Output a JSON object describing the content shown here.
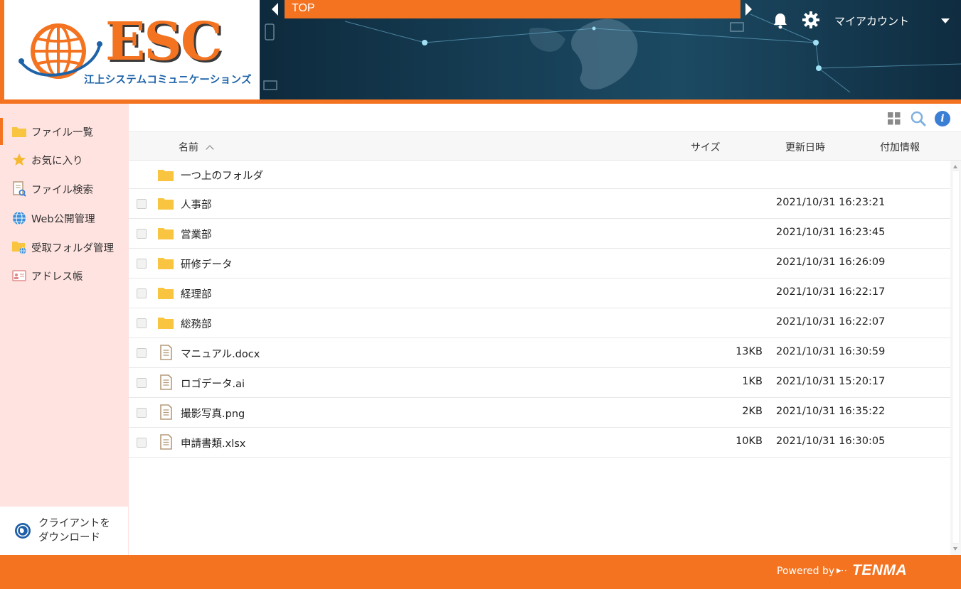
{
  "brand": {
    "logo_text": "ESC",
    "company_name": "江上システムコミュニケーションズ",
    "accent": "#f47320",
    "blue": "#1e63a8"
  },
  "header": {
    "breadcrumb": "TOP",
    "account_label": "マイアカウント"
  },
  "sidebar": {
    "items": [
      {
        "label": "ファイル一覧",
        "icon": "folder-icon",
        "active": true
      },
      {
        "label": "お気に入り",
        "icon": "star-icon"
      },
      {
        "label": "ファイル検索",
        "icon": "file-search-icon"
      },
      {
        "label": "Web公開管理",
        "icon": "globe-icon"
      },
      {
        "label": "受取フォルダ管理",
        "icon": "folder-globe-icon"
      },
      {
        "label": "アドレス帳",
        "icon": "address-card-icon"
      }
    ],
    "client_download_line1": "クライアントを",
    "client_download_line2": "ダウンロード"
  },
  "table": {
    "columns": {
      "name": "名前",
      "size": "サイズ",
      "updated": "更新日時",
      "extra": "付加情報"
    },
    "parent_folder": "一つ上のフォルダ",
    "rows": [
      {
        "type": "folder",
        "name": "人事部",
        "size": "",
        "date": "2021/10/31 16:23:21"
      },
      {
        "type": "folder",
        "name": "営業部",
        "size": "",
        "date": "2021/10/31 16:23:45"
      },
      {
        "type": "folder",
        "name": "研修データ",
        "size": "",
        "date": "2021/10/31 16:26:09"
      },
      {
        "type": "folder",
        "name": "経理部",
        "size": "",
        "date": "2021/10/31 16:22:17"
      },
      {
        "type": "folder",
        "name": "総務部",
        "size": "",
        "date": "2021/10/31 16:22:07"
      },
      {
        "type": "file",
        "name": "マニュアル.docx",
        "size": "13KB",
        "date": "2021/10/31 16:30:59"
      },
      {
        "type": "file",
        "name": "ロゴデータ.ai",
        "size": "1KB",
        "date": "2021/10/31 15:20:17"
      },
      {
        "type": "file",
        "name": "撮影写真.png",
        "size": "2KB",
        "date": "2021/10/31 16:35:22"
      },
      {
        "type": "file",
        "name": "申請書類.xlsx",
        "size": "10KB",
        "date": "2021/10/31 16:30:05"
      }
    ]
  },
  "footer": {
    "powered_by": "Powered by ···",
    "vendor": "TENMA"
  }
}
